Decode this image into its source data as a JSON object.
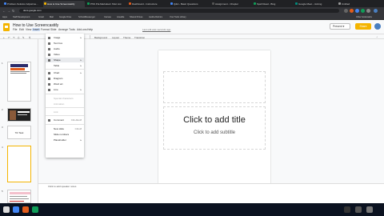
{
  "browser": {
    "tabs": [
      {
        "label": "Problem-Solution Adjustme...",
        "color": "#4285f4"
      },
      {
        "label": "How to Use Screencastify",
        "color": "#f4b400",
        "active": true
      },
      {
        "label": "PSS Pol-Markdown Shot List",
        "color": "#0f9d58"
      },
      {
        "label": "Dashboard - Instructure",
        "color": "#e25c1b"
      },
      {
        "label": "Q&A - Basic Questions",
        "color": "#4285f4"
      },
      {
        "label": "Assignment - Chapter",
        "color": "#555555"
      },
      {
        "label": "Spell Read - Bing",
        "color": "#0f9d58"
      },
      {
        "label": "Google Meet - Joining",
        "color": "#00897b"
      },
      {
        "label": "Untitled",
        "color": "#999999"
      }
    ],
    "url": "docs.google.com",
    "bookmarks": [
      "Apps",
      "Staff Development",
      "Gmail",
      "Mail",
      "Google Drive",
      "SchoolMessenger",
      "Canvas",
      "Aceable",
      "Shared Drives",
      "Audria Rubrics",
      "Your Tools Library",
      "Other bookmarks"
    ]
  },
  "app": {
    "title": "How to Use Screencastify",
    "menus": [
      "File",
      "Edit",
      "View",
      "Insert",
      "Format",
      "Slide",
      "Arrange",
      "Tools",
      "Add-ons",
      "Help"
    ],
    "open_menu": "Insert",
    "last_edit": "Last edit was seconds ago",
    "present_label": "Present",
    "share_label": "Share",
    "toolbar": [
      "Background",
      "Layout",
      "Theme",
      "Transition"
    ],
    "notes_placeholder": "Click to add speaker notes",
    "brand_color": "#f4b400"
  },
  "slides": [
    {
      "num": "1"
    },
    {
      "num": "2"
    },
    {
      "num": "3",
      "text": "Tilt Task"
    },
    {
      "num": "4"
    },
    {
      "num": "5"
    }
  ],
  "slide": {
    "title": "Click to add title",
    "subtitle": "Click to add subtitle"
  },
  "insert_menu": [
    {
      "label": "Image",
      "arrow": true
    },
    {
      "label": "Text box"
    },
    {
      "label": "Audio"
    },
    {
      "label": "Video"
    },
    {
      "label": "Shape",
      "arrow": true,
      "highlighted": true
    },
    {
      "label": "Table",
      "arrow": true
    },
    {
      "label": "Chart",
      "arrow": true
    },
    {
      "label": "Diagram"
    },
    {
      "label": "Word art"
    },
    {
      "label": "Line",
      "arrow": true
    },
    {
      "label": "Special characters",
      "disabled": true
    },
    {
      "label": "Animation",
      "disabled": true
    },
    {
      "label": "Link",
      "disabled": true
    },
    {
      "label": "Comment",
      "shortcut": "Ctrl+Alt+M"
    },
    {
      "label": "New slide",
      "shortcut": "Ctrl+M"
    },
    {
      "label": "Slide numbers"
    },
    {
      "label": "Placeholder",
      "arrow": true
    }
  ]
}
